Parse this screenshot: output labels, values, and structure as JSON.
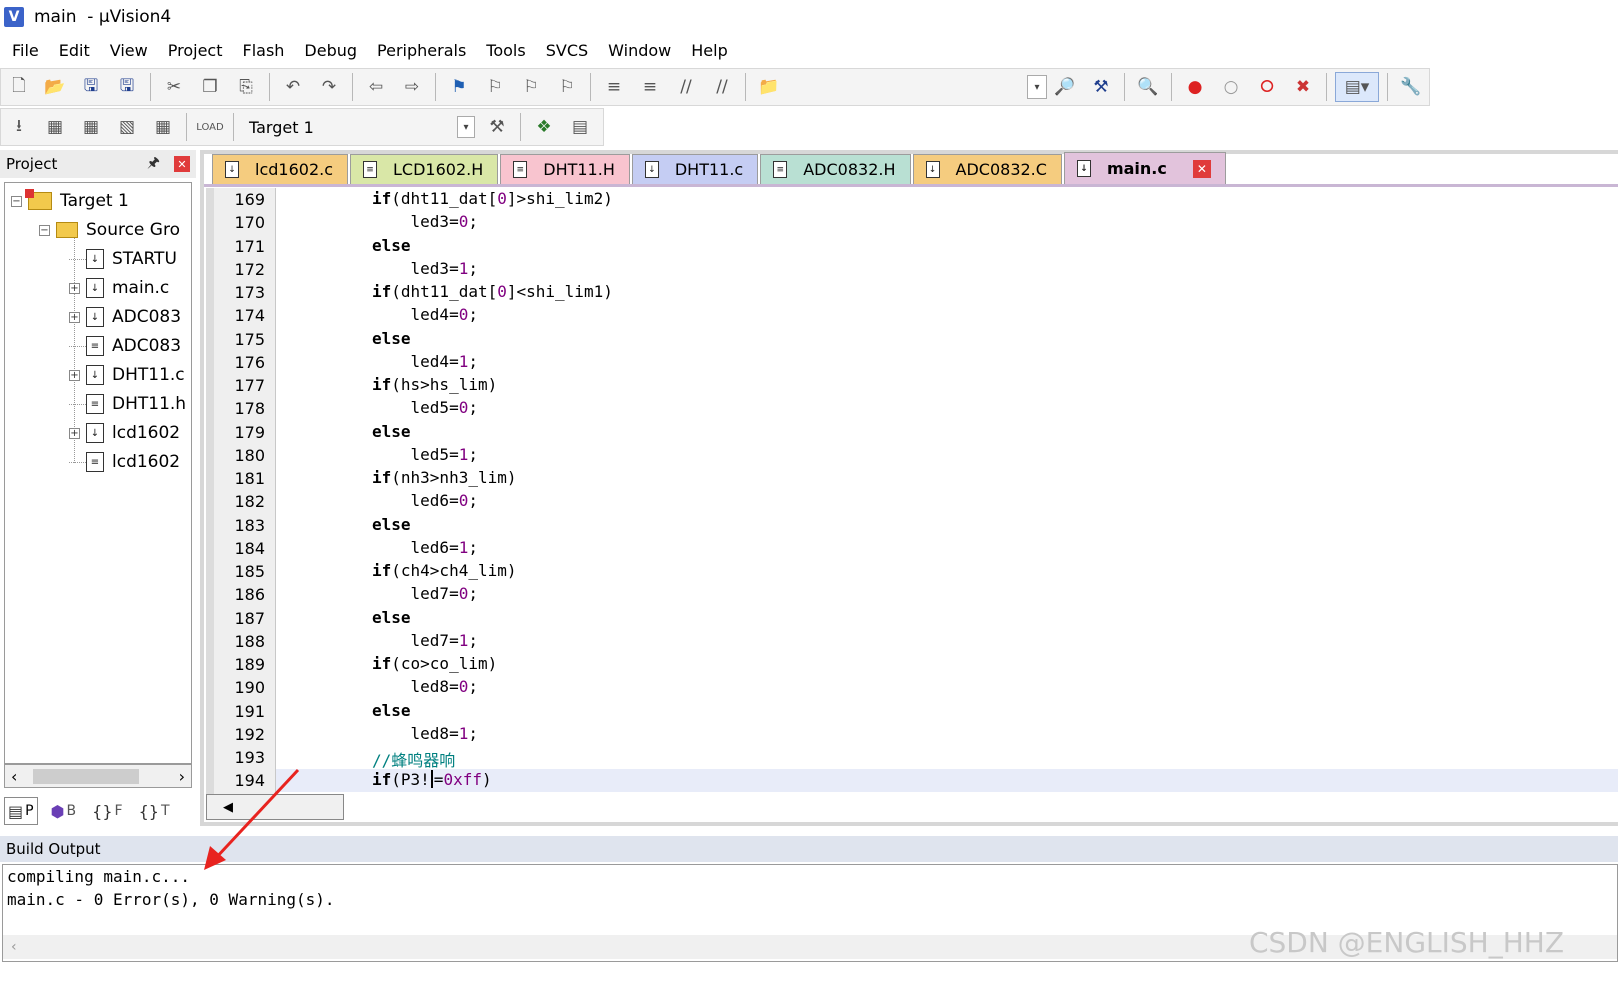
{
  "window": {
    "title": "main  - µVision4",
    "app_icon": "V"
  },
  "menu": [
    "File",
    "Edit",
    "View",
    "Project",
    "Flash",
    "Debug",
    "Peripherals",
    "Tools",
    "SVCS",
    "Window",
    "Help"
  ],
  "toolbar": {
    "target_name": "Target 1"
  },
  "project_panel": {
    "title": "Project",
    "tree": [
      {
        "label": "Target 1",
        "type": "target"
      },
      {
        "label": "Source Gro",
        "type": "folder"
      },
      {
        "label": "STARTU",
        "type": "file"
      },
      {
        "label": "main.c",
        "type": "file"
      },
      {
        "label": "ADC083",
        "type": "file"
      },
      {
        "label": "ADC083",
        "type": "file"
      },
      {
        "label": "DHT11.c",
        "type": "file"
      },
      {
        "label": "DHT11.h",
        "type": "file"
      },
      {
        "label": "lcd1602",
        "type": "file"
      },
      {
        "label": "lcd1602",
        "type": "file"
      }
    ],
    "tabs": [
      {
        "icon": "project-icon",
        "label": "P"
      },
      {
        "icon": "books-icon",
        "label": "B"
      },
      {
        "icon": "functions-icon",
        "label": "F"
      },
      {
        "icon": "templates-icon",
        "label": "T"
      }
    ]
  },
  "editor_tabs": [
    {
      "label": "lcd1602.c",
      "color": "#f5cc7f"
    },
    {
      "label": "LCD1602.H",
      "color": "#d9e7a7"
    },
    {
      "label": "DHT11.H",
      "color": "#f8c4cf"
    },
    {
      "label": "DHT11.c",
      "color": "#c5cdf3"
    },
    {
      "label": "ADC0832.H",
      "color": "#b9e0d3"
    },
    {
      "label": "ADC0832.C",
      "color": "#f5cc7f"
    },
    {
      "label": "main.c",
      "color": "#e2c3dc",
      "active": true
    }
  ],
  "editor": {
    "line_numbers": [
      "169",
      "170",
      "171",
      "172",
      "173",
      "174",
      "175",
      "176",
      "177",
      "178",
      "179",
      "180",
      "181",
      "182",
      "183",
      "184",
      "185",
      "186",
      "187",
      "188",
      "189",
      "190",
      "191",
      "192",
      "193",
      "194"
    ],
    "code": [
      "if(dht11_dat[0]>shi_lim2)",
      "    led3=0;",
      "else",
      "    led3=1;",
      "if(dht11_dat[0]<shi_lim1)",
      "    led4=0;",
      "else",
      "    led4=1;",
      "if(hs>hs_lim)",
      "    led5=0;",
      "else",
      "    led5=1;",
      "if(nh3>nh3_lim)",
      "    led6=0;",
      "else",
      "    led6=1;",
      "if(ch4>ch4_lim)",
      "    led7=0;",
      "else",
      "    led7=1;",
      "if(co>co_lim)",
      "    led8=0;",
      "else",
      "    led8=1;",
      "//蜂鸣器响",
      "if(P3!=0xff)"
    ]
  },
  "build_output": {
    "title": "Build Output",
    "lines": [
      "compiling main.c...",
      "main.c - 0 Error(s), 0 Warning(s)."
    ]
  },
  "watermark": "CSDN @ENGLISH_HHZ",
  "colors": {
    "annotation_arrow": "#e8231f",
    "number_literal": "#800080",
    "comment": "#008080"
  }
}
